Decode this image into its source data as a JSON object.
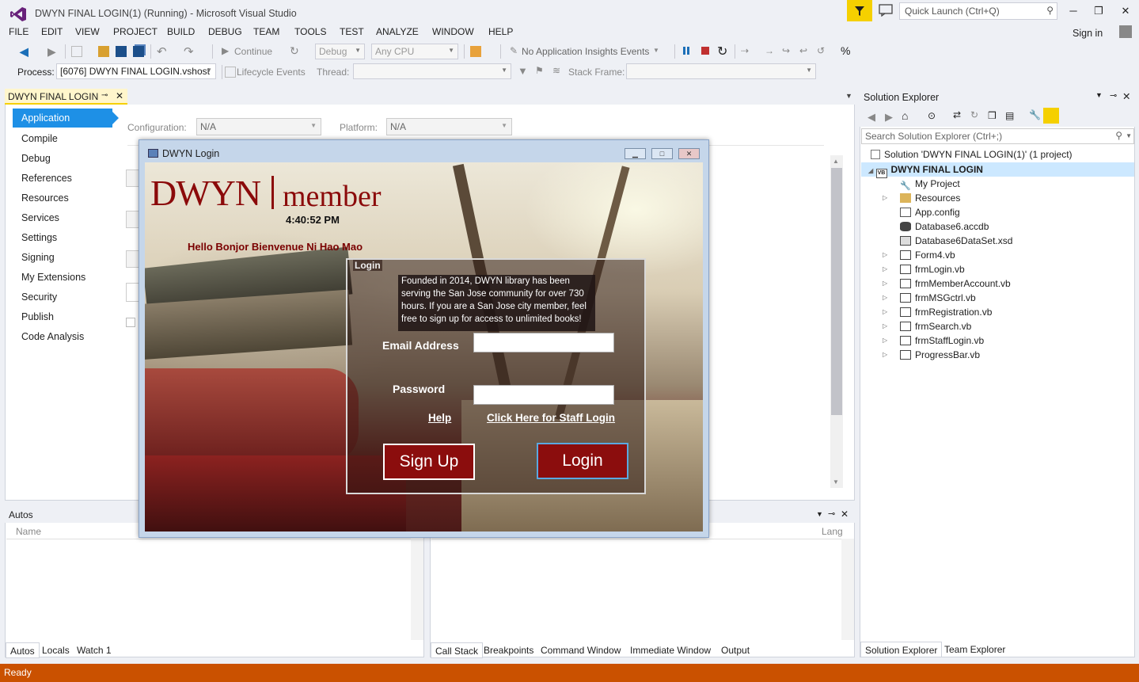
{
  "window": {
    "title": "DWYN FINAL LOGIN(1) (Running) - Microsoft Visual Studio",
    "quick_launch_placeholder": "Quick Launch (Ctrl+Q)",
    "sign_in": "Sign in"
  },
  "menu": [
    "FILE",
    "EDIT",
    "VIEW",
    "PROJECT",
    "BUILD",
    "DEBUG",
    "TEAM",
    "TOOLS",
    "TEST",
    "ANALYZE",
    "WINDOW",
    "HELP"
  ],
  "toolbar": {
    "continue": "Continue",
    "config": "Debug",
    "platform": "Any CPU",
    "insights": "No Application Insights Events",
    "process_label": "Process:",
    "process_value": "[6076] DWYN FINAL LOGIN.vshost",
    "lifecycle": "Lifecycle Events",
    "thread_label": "Thread:",
    "stack_frame_label": "Stack Frame:"
  },
  "doc_tab": {
    "label": "DWYN FINAL LOGIN"
  },
  "project_props": {
    "nav": [
      "Application",
      "Compile",
      "Debug",
      "References",
      "Resources",
      "Services",
      "Settings",
      "Signing",
      "My Extensions",
      "Security",
      "Publish",
      "Code Analysis"
    ],
    "configuration_label": "Configuration:",
    "configuration_value": "N/A",
    "platform_label": "Platform:",
    "platform_value": "N/A"
  },
  "dialog": {
    "title": "DWYN Login",
    "logo_left": "DWYN",
    "logo_right": "member",
    "clock": "4:40:52 PM",
    "greeting": "Hello Bonjor Bienvenue Ni Hao Mao",
    "group_label": "Login",
    "blurb": "Founded in 2014, DWYN library has been serving the San Jose community for over 730 hours. If you are a San Jose city member, feel free to sign up for access to unlimited books!",
    "email_label": "Email Address",
    "password_label": "Password",
    "help_link": "Help",
    "staff_link": "Click Here for Staff Login",
    "signup_button": "Sign Up",
    "login_button": "Login"
  },
  "solution_explorer": {
    "title": "Solution Explorer",
    "search_placeholder": "Search Solution Explorer (Ctrl+;)",
    "solution": "Solution 'DWYN FINAL LOGIN(1)' (1 project)",
    "project": "DWYN FINAL LOGIN",
    "items": [
      "My Project",
      "Resources",
      "App.config",
      "Database6.accdb",
      "Database6DataSet.xsd",
      "Form4.vb",
      "frmLogin.vb",
      "frmMemberAccount.vb",
      "frmMSGctrl.vb",
      "frmRegistration.vb",
      "frmSearch.vb",
      "frmStaffLogin.vb",
      "ProgressBar.vb"
    ],
    "tabs": [
      "Solution Explorer",
      "Team Explorer"
    ]
  },
  "autos": {
    "title": "Autos",
    "col_name": "Name",
    "tabs": [
      "Autos",
      "Locals",
      "Watch 1"
    ]
  },
  "callstack": {
    "col_lang": "Lang",
    "tabs": [
      "Call Stack",
      "Breakpoints",
      "Command Window",
      "Immediate Window",
      "Output"
    ]
  },
  "status": "Ready"
}
